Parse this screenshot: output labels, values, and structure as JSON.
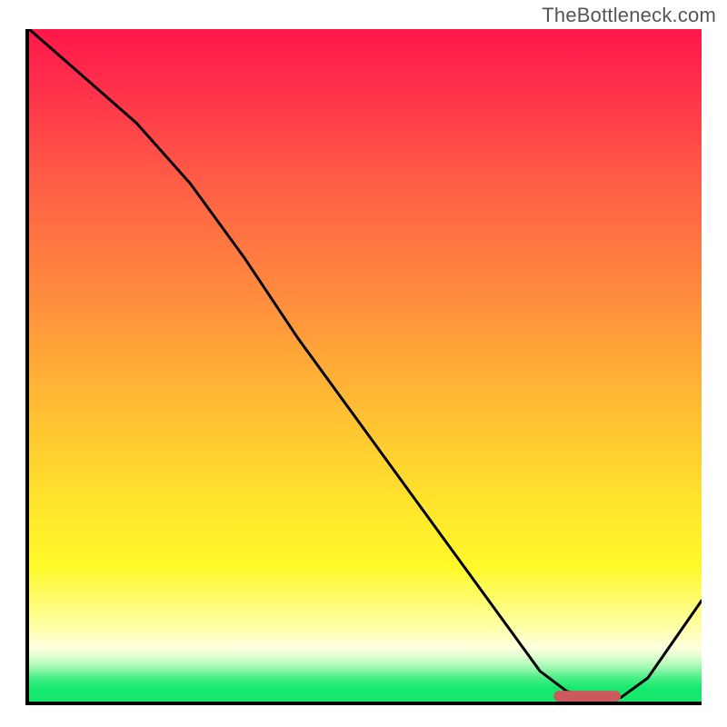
{
  "watermark": "TheBottleneck.com",
  "chart_data": {
    "type": "line",
    "title": "",
    "xlabel": "",
    "ylabel": "",
    "xlim": [
      0,
      100
    ],
    "ylim": [
      0,
      100
    ],
    "grid": false,
    "curve": {
      "name": "bottleneck-curve",
      "x": [
        0,
        8,
        16,
        24,
        32,
        40,
        48,
        56,
        64,
        72,
        76,
        80,
        84,
        88,
        92,
        100
      ],
      "y": [
        100,
        93,
        86,
        77,
        66,
        54,
        43,
        32,
        21,
        10,
        4.5,
        1.5,
        0.6,
        0.6,
        3.5,
        15
      ]
    },
    "marker": {
      "name": "optimal-range",
      "x_start": 78,
      "x_end": 88,
      "y": 0.8
    },
    "background_scale": {
      "type": "vertical-gradient",
      "stops": [
        {
          "pos": 0.0,
          "color": "#ff174b"
        },
        {
          "pos": 0.07,
          "color": "#ff2b4b"
        },
        {
          "pos": 0.22,
          "color": "#ff5b46"
        },
        {
          "pos": 0.4,
          "color": "#ff8d3e"
        },
        {
          "pos": 0.55,
          "color": "#ffb934"
        },
        {
          "pos": 0.7,
          "color": "#ffe32c"
        },
        {
          "pos": 0.8,
          "color": "#fff92a"
        },
        {
          "pos": 0.89,
          "color": "#fdffa7"
        },
        {
          "pos": 0.92,
          "color": "#ffffe0"
        },
        {
          "pos": 0.935,
          "color": "#d9ffcd"
        },
        {
          "pos": 0.95,
          "color": "#9bf7af"
        },
        {
          "pos": 0.965,
          "color": "#49ee86"
        },
        {
          "pos": 0.98,
          "color": "#17e96f"
        },
        {
          "pos": 1.0,
          "color": "#15e96e"
        }
      ]
    }
  }
}
